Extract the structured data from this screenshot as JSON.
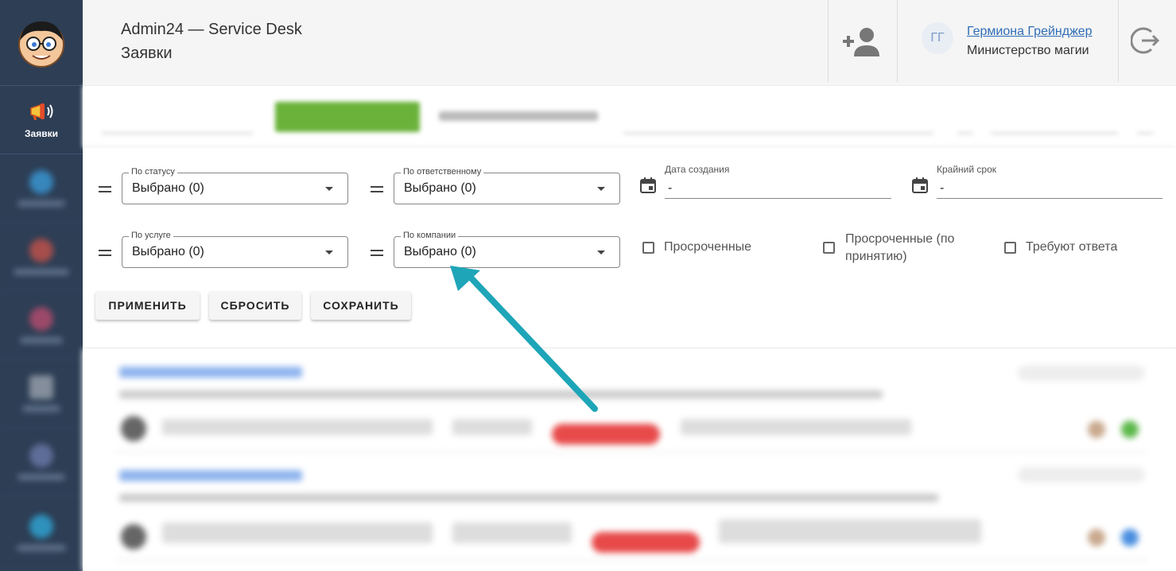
{
  "header": {
    "app_title": "Admin24 — Service Desk",
    "page_title": "Заявки",
    "user_initials": "ГГ",
    "user_name": "Гермиона Грейнджер",
    "user_org": "Министерство магии"
  },
  "sidebar": {
    "active_label": "Заявки"
  },
  "filters": {
    "status": {
      "label": "По статусу",
      "value": "Выбрано (0)"
    },
    "responsible": {
      "label": "По ответственному",
      "value": "Выбрано (0)"
    },
    "service": {
      "label": "По услуге",
      "value": "Выбрано (0)"
    },
    "company": {
      "label": "По компании",
      "value": "Выбрано (0)"
    },
    "created": {
      "label": "Дата создания",
      "value": "-"
    },
    "deadline": {
      "label": "Крайний срок",
      "value": "-"
    },
    "overdue": "Просроченные",
    "overdue_accept": "Просроченные (по принятию)",
    "need_reply": "Требуют ответа"
  },
  "buttons": {
    "apply": "ПРИМЕНИТЬ",
    "reset": "СБРОСИТЬ",
    "save": "СОХРАНИТЬ"
  },
  "colors": {
    "sidebar": "#2d3e55",
    "accent_link": "#2f6db5",
    "arrow": "#1ea5b8"
  }
}
